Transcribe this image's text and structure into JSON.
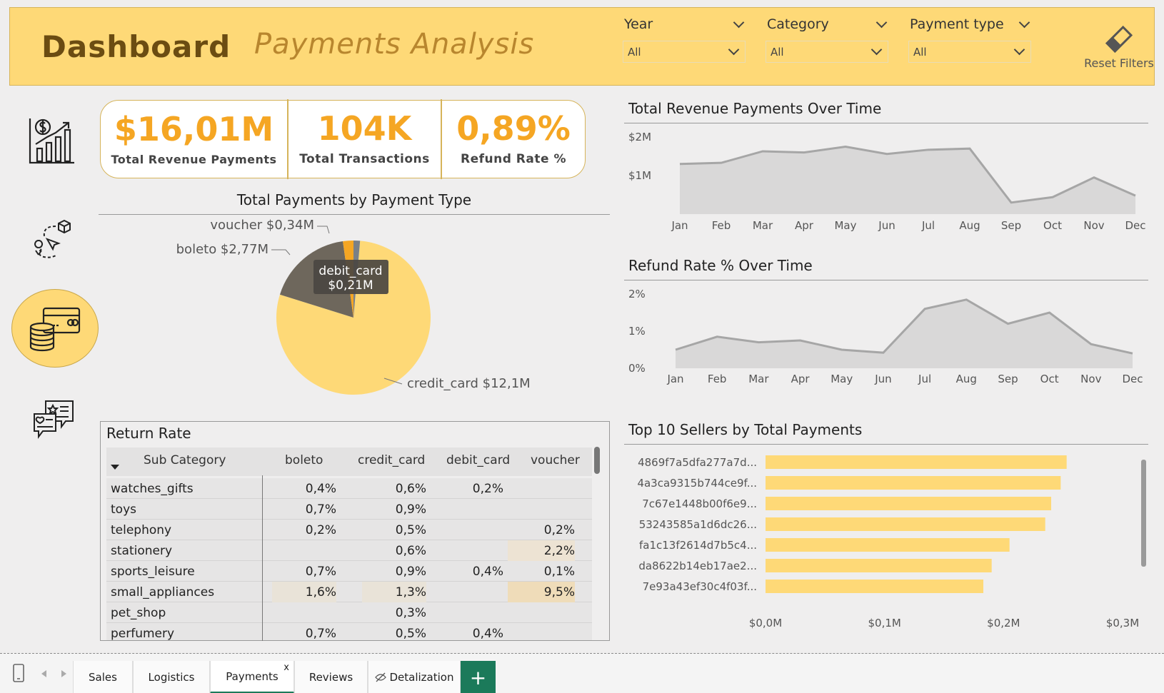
{
  "header": {
    "title": "Dashboard",
    "subtitle": "Payments Analysis",
    "filters": [
      {
        "label": "Year",
        "value": "All"
      },
      {
        "label": "Category",
        "value": "All"
      },
      {
        "label": "Payment type",
        "value": "All"
      }
    ],
    "reset_label": "Reset Filters"
  },
  "nav": {
    "items": [
      "sales-chart-icon",
      "logistics-route-icon",
      "payments-coins-icon",
      "reviews-chat-icon"
    ],
    "active": "payments-coins-icon"
  },
  "kpis": [
    {
      "value": "$16,01M",
      "caption": "Total Revenue Payments"
    },
    {
      "value": "104K",
      "caption": "Total Transactions"
    },
    {
      "value": "0,89%",
      "caption": "Refund Rate %"
    }
  ],
  "pie": {
    "title": "Total Payments by Payment Type",
    "tooltip_name": "debit_card",
    "tooltip_value": "$0,21M"
  },
  "return_rate": {
    "title": "Return Rate",
    "columns": [
      "Sub Category",
      "boleto",
      "credit_card",
      "debit_card",
      "voucher"
    ],
    "rows": [
      [
        "watches_gifts",
        "0,4%",
        "0,6%",
        "0,2%",
        ""
      ],
      [
        "toys",
        "0,7%",
        "0,9%",
        "",
        ""
      ],
      [
        "telephony",
        "0,2%",
        "0,5%",
        "",
        "0,2%"
      ],
      [
        "stationery",
        "",
        "0,6%",
        "",
        "2,2%"
      ],
      [
        "sports_leisure",
        "0,7%",
        "0,9%",
        "0,4%",
        "0,1%"
      ],
      [
        "small_appliances",
        "1,6%",
        "1,3%",
        "",
        "9,5%"
      ],
      [
        "pet_shop",
        "",
        "0,3%",
        "",
        ""
      ],
      [
        "perfumery",
        "0,7%",
        "0,5%",
        "0,4%",
        ""
      ]
    ]
  },
  "chart_data": [
    {
      "type": "area",
      "title": "Total Revenue Payments Over Time",
      "categories": [
        "Jan",
        "Feb",
        "Mar",
        "Apr",
        "May",
        "Jun",
        "Jul",
        "Aug",
        "Sep",
        "Oct",
        "Nov",
        "Dec"
      ],
      "values": [
        1.3,
        1.33,
        1.63,
        1.6,
        1.75,
        1.56,
        1.67,
        1.7,
        0.3,
        0.44,
        0.95,
        0.48
      ],
      "yticks": [
        "$1M",
        "$2M"
      ],
      "ylim": [
        0,
        2
      ],
      "color": "#a6a6a6"
    },
    {
      "type": "area",
      "title": "Refund Rate % Over Time",
      "categories": [
        "Jan",
        "Feb",
        "Mar",
        "Apr",
        "May",
        "Jun",
        "Jul",
        "Aug",
        "Sep",
        "Oct",
        "Nov",
        "Dec"
      ],
      "values": [
        0.5,
        0.85,
        0.7,
        0.75,
        0.5,
        0.42,
        1.6,
        1.85,
        1.2,
        1.5,
        0.65,
        0.4
      ],
      "yticks": [
        "0%",
        "1%",
        "2%"
      ],
      "ylim": [
        0,
        2
      ],
      "color": "#a6a6a6"
    },
    {
      "type": "pie",
      "title": "Total Payments by Payment Type",
      "slices": [
        {
          "name": "credit_card",
          "value": 12.1,
          "label": "credit_card $12,1M",
          "color": "#fed977"
        },
        {
          "name": "boleto",
          "value": 2.77,
          "label": "boleto $2,77M",
          "color": "#6e675c"
        },
        {
          "name": "voucher",
          "value": 0.34,
          "label": "voucher $0,34M",
          "color": "#f5a623"
        },
        {
          "name": "debit_card",
          "value": 0.21,
          "label": "",
          "color": "#7a8088"
        }
      ]
    },
    {
      "type": "bar",
      "orientation": "horizontal",
      "title": "Top 10 Sellers by Total Payments",
      "categories": [
        "4869f7a5dfa277a7d...",
        "4a3ca9315b744ce9f...",
        "7c67e1448b00f6e9...",
        "53243585a1d6dc26...",
        "fa1c13f2614d7b5c4...",
        "da8622b14eb17ae2...",
        "7e93a43ef30c4f03f..."
      ],
      "values": [
        0.253,
        0.248,
        0.24,
        0.235,
        0.205,
        0.19,
        0.183
      ],
      "xticks": [
        "$0,0M",
        "$0,1M",
        "$0,2M",
        "$0,3M"
      ],
      "xlim": [
        0,
        0.3
      ],
      "color": "#fed977"
    }
  ],
  "tabs": [
    "Sales",
    "Logistics",
    "Payments",
    "Reviews",
    "Detalization"
  ],
  "active_tab": "Payments",
  "tab_close": "x",
  "tab_add": "+"
}
